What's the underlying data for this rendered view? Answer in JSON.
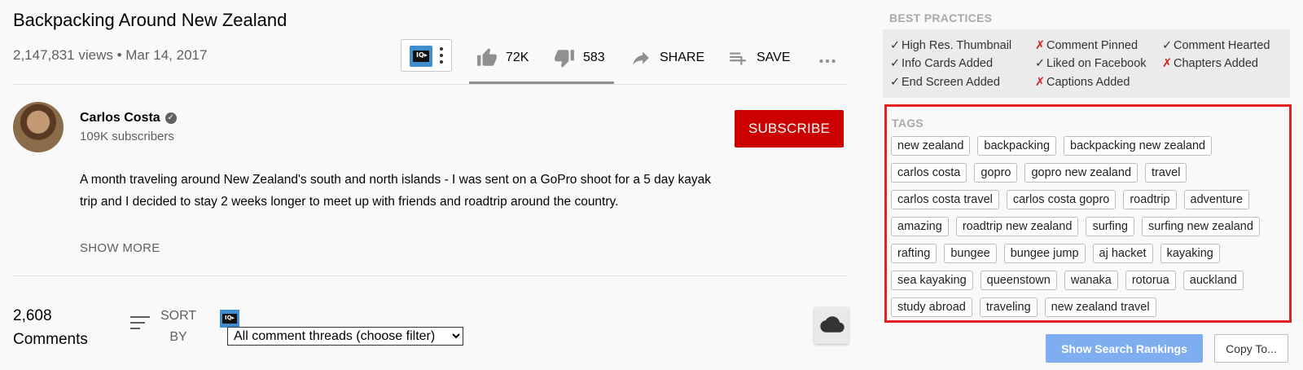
{
  "video": {
    "title": "Backpacking Around New Zealand",
    "meta": "2,147,831 views • Mar 14, 2017",
    "likes": "72K",
    "dislikes": "583",
    "share_label": "SHARE",
    "save_label": "SAVE",
    "like_ratio": 0.992
  },
  "channel": {
    "name": "Carlos Costa",
    "subscribers": "109K subscribers",
    "subscribe_label": "SUBSCRIBE"
  },
  "description": {
    "text": "A month traveling around New Zealand's south and north islands - I was sent on a GoPro shoot for a 5 day kayak trip and I decided to stay 2 weeks longer to meet up with friends and roadtrip around the country.",
    "show_more": "SHOW MORE"
  },
  "comments": {
    "count": "2,608",
    "label": "Comments",
    "sort_by": "SORT BY",
    "filter_value": "All comment threads (choose filter)"
  },
  "best_practices": {
    "label": "BEST PRACTICES",
    "items": [
      {
        "mark": "✓",
        "status": "ok",
        "text": "High Res. Thumbnail"
      },
      {
        "mark": "✗",
        "status": "bad",
        "text": "Comment Pinned"
      },
      {
        "mark": "✓",
        "status": "ok",
        "text": "Comment Hearted"
      },
      {
        "mark": "✓",
        "status": "ok",
        "text": "Info Cards Added"
      },
      {
        "mark": "✓",
        "status": "ok",
        "text": "Liked on Facebook"
      },
      {
        "mark": "✗",
        "status": "bad",
        "text": "Chapters Added"
      },
      {
        "mark": "✓",
        "status": "ok",
        "text": "End Screen Added"
      },
      {
        "mark": "✗",
        "status": "bad",
        "text": "Captions Added"
      }
    ]
  },
  "tags": {
    "label": "TAGS",
    "items": [
      "new zealand",
      "backpacking",
      "backpacking new zealand",
      "carlos costa",
      "gopro",
      "gopro new zealand",
      "travel",
      "carlos costa travel",
      "carlos costa gopro",
      "roadtrip",
      "adventure",
      "amazing",
      "roadtrip new zealand",
      "surfing",
      "surfing new zealand",
      "rafting",
      "bungee",
      "bungee jump",
      "aj hacket",
      "kayaking",
      "sea kayaking",
      "queenstown",
      "wanaka",
      "rotorua",
      "auckland",
      "study abroad",
      "traveling",
      "new zealand travel"
    ]
  },
  "buttons": {
    "show_rankings": "Show Search Rankings",
    "copy_to": "Copy To..."
  },
  "colors": {
    "subscribe": "#cc0000",
    "highlight_border": "#e12020",
    "rank_button": "#7faef0",
    "fail_mark": "#d62020"
  },
  "icons": [
    "extension-logo-icon",
    "kebab-icon",
    "thumbs-up-icon",
    "thumbs-down-icon",
    "share-arrow-icon",
    "playlist-add-icon",
    "more-horiz-icon",
    "verified-icon",
    "sort-icon",
    "cloud-icon"
  ]
}
